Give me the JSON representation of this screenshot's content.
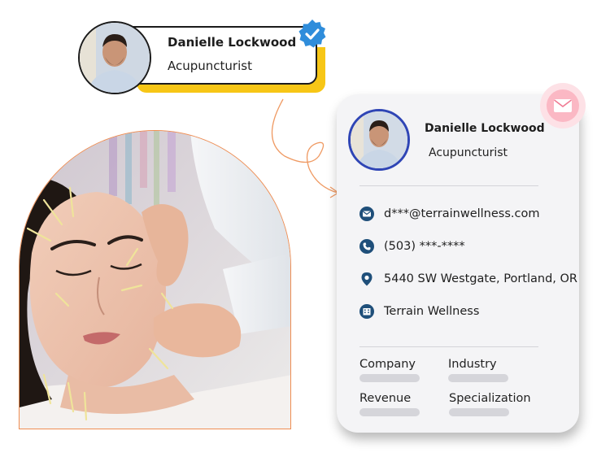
{
  "profile_pill": {
    "name": "Danielle Lockwood",
    "title": "Acupuncturist",
    "badge_icon": "verified-check-icon",
    "accent_color": "#f7c616"
  },
  "contact_card": {
    "name": "Danielle Lockwood",
    "title": "Acupuncturist",
    "email": "d***@terrainwellness.com",
    "phone": "(503) ***-****",
    "address": "5440 SW Westgate, Portland, OR",
    "company": "Terrain Wellness",
    "fields": [
      {
        "label": "Company"
      },
      {
        "label": "Industry"
      },
      {
        "label": "Revenue"
      },
      {
        "label": "Specialization"
      }
    ],
    "icons": [
      "mail-icon",
      "phone-icon",
      "location-pin-icon",
      "building-icon"
    ],
    "icon_color": "#1f4f7a",
    "mail_badge_icon": "envelope-icon"
  },
  "photo": {
    "border_color": "#ef8d52"
  }
}
